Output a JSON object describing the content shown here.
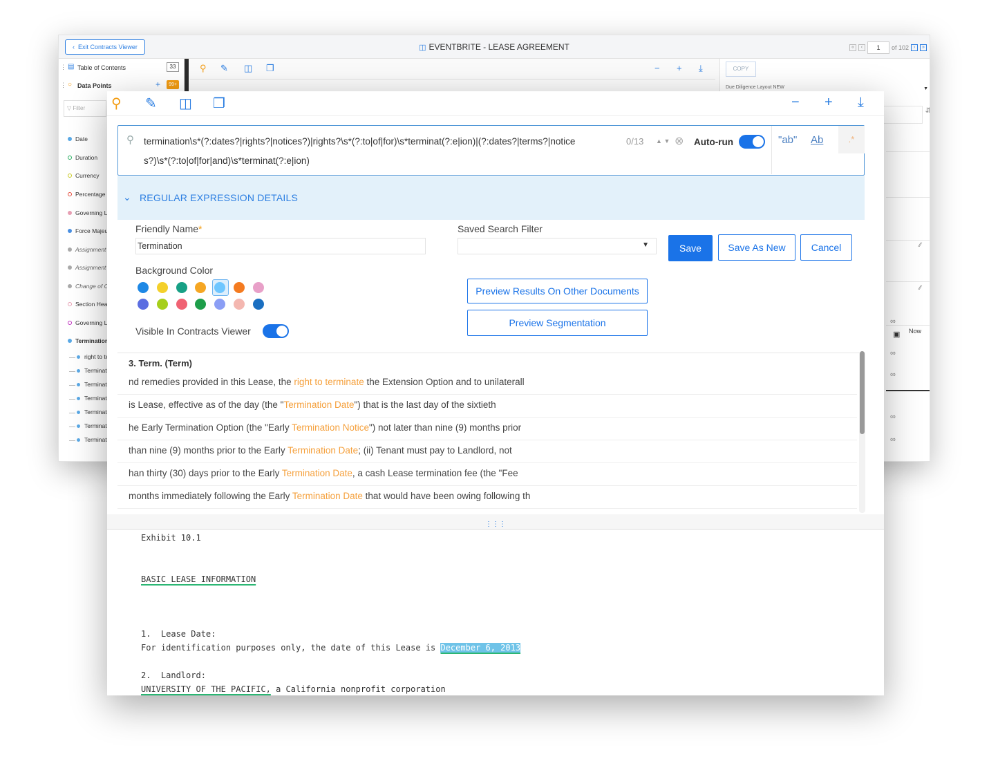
{
  "app": {
    "exit_label": "Exit Contracts Viewer",
    "title": "EVENTBRITE - LEASE AGREEMENT",
    "page_current": "1",
    "page_total": "of 102"
  },
  "sidebar": {
    "toc_label": "Table of Contents",
    "toc_count": "33",
    "datapoints_label": "Data Points",
    "datapoints_badge": "99+",
    "filter_placeholder": "Filter",
    "items": [
      {
        "label": "Date",
        "color": "#5aa9e6",
        "style": "filled"
      },
      {
        "label": "Duration",
        "color": "#27ae60",
        "style": "outline"
      },
      {
        "label": "Currency",
        "color": "#c9c91f",
        "style": "outline"
      },
      {
        "label": "Percentage",
        "color": "#e74c3c",
        "style": "outline"
      },
      {
        "label": "Governing Law",
        "color": "#e8a0b4",
        "style": "filled"
      },
      {
        "label": "Force Majeure",
        "color": "#4a90e2",
        "style": "filled"
      },
      {
        "label": "Assignment",
        "color": "#aaaaaa",
        "style": "filled",
        "italic": true
      },
      {
        "label": "Assignment",
        "color": "#aaaaaa",
        "style": "filled",
        "italic": true
      },
      {
        "label": "Change of Control",
        "color": "#aaaaaa",
        "style": "filled",
        "italic": true
      },
      {
        "label": "Section Headings",
        "color": "#e8a0b4",
        "style": "outline"
      },
      {
        "label": "Governing Law",
        "color": "#c030c0",
        "style": "outline"
      },
      {
        "label": "Termination",
        "color": "#5aa9e6",
        "style": "filled",
        "bold": true
      }
    ],
    "sub_items": [
      "right to terminate",
      "Termination",
      "Termination",
      "Termination",
      "Termination",
      "Termination",
      "Termination"
    ]
  },
  "right_panel": {
    "copy_label": "COPY",
    "layout_label": "Due Diligence Layout NEW",
    "now_label": "Now"
  },
  "search": {
    "regex_line1": "termination\\s*(?:dates?|rights?|notices?)|rights?\\s*(?:to|of|for)\\s*terminat(?:e|ion)|(?:dates?|terms?|notice",
    "regex_line2": "s?)\\s*(?:to|of|for|and)\\s*terminat(?:e|ion)",
    "match_count": "0/13",
    "autorun_label": "Auto-run",
    "opt_whole_word": "\"ab\"",
    "opt_match_case": "Ab",
    "opt_regex": ".*"
  },
  "details": {
    "section_title": "REGULAR EXPRESSION DETAILS",
    "friendly_label": "Friendly Name",
    "required_mark": "*",
    "friendly_value": "Termination",
    "saved_filter_label": "Saved Search Filter",
    "save_label": "Save",
    "save_as_new_label": "Save As New",
    "cancel_label": "Cancel",
    "bg_color_label": "Background Color",
    "colors_row1": [
      "#1e88e5",
      "#f4d02b",
      "#17a085",
      "#f5a623",
      "#6ec6ff",
      "#f47b20",
      "#e8a0c8"
    ],
    "colors_row2": [
      "#5b6ee1",
      "#a6cf1b",
      "#f06273",
      "#1e9e4a",
      "#8b9ef5",
      "#f4b7b0",
      "#1a6fc1"
    ],
    "preview_other_label": "Preview Results On Other Documents",
    "preview_seg_label": "Preview Segmentation",
    "visible_label": "Visible In Contracts Viewer"
  },
  "results": {
    "heading": "3. Term. (Term)",
    "rows": [
      {
        "pre": "nd remedies provided in this Lease, the ",
        "match": "right to terminate",
        "post": " the Extension Option and to unilaterall"
      },
      {
        "pre": "is Lease, effective as of the day (the \"",
        "match": "Termination Date",
        "post": "\") that is the last day of the sixtieth"
      },
      {
        "pre": "he Early Termination Option (the \"Early ",
        "match": "Termination Notice",
        "post": "\") not later than nine (9) months prior"
      },
      {
        "pre": "than nine (9) months prior to the Early ",
        "match": "Termination Date",
        "post": "; (ii) Tenant must pay to Landlord, not"
      },
      {
        "pre": "han thirty (30) days prior to the Early ",
        "match": "Termination Date",
        "post": ", a cash Lease termination fee (the \"Fee"
      },
      {
        "pre": "months immediately following the Early ",
        "match": "Termination Date",
        "post": " that would have been owing following th"
      }
    ]
  },
  "document": {
    "exhibit": "Exhibit 10.1",
    "heading": "BASIC LEASE INFORMATION",
    "item1_title": "1.  Lease Date:",
    "item1_text": "For identification purposes only, the date of this Lease is ",
    "item1_date": "December 6, 2013",
    "item2_title": "2.  Landlord:",
    "item2_name": "UNIVERSITY OF THE PACIFIC,",
    "item2_rest": " a California nonprofit corporation"
  }
}
